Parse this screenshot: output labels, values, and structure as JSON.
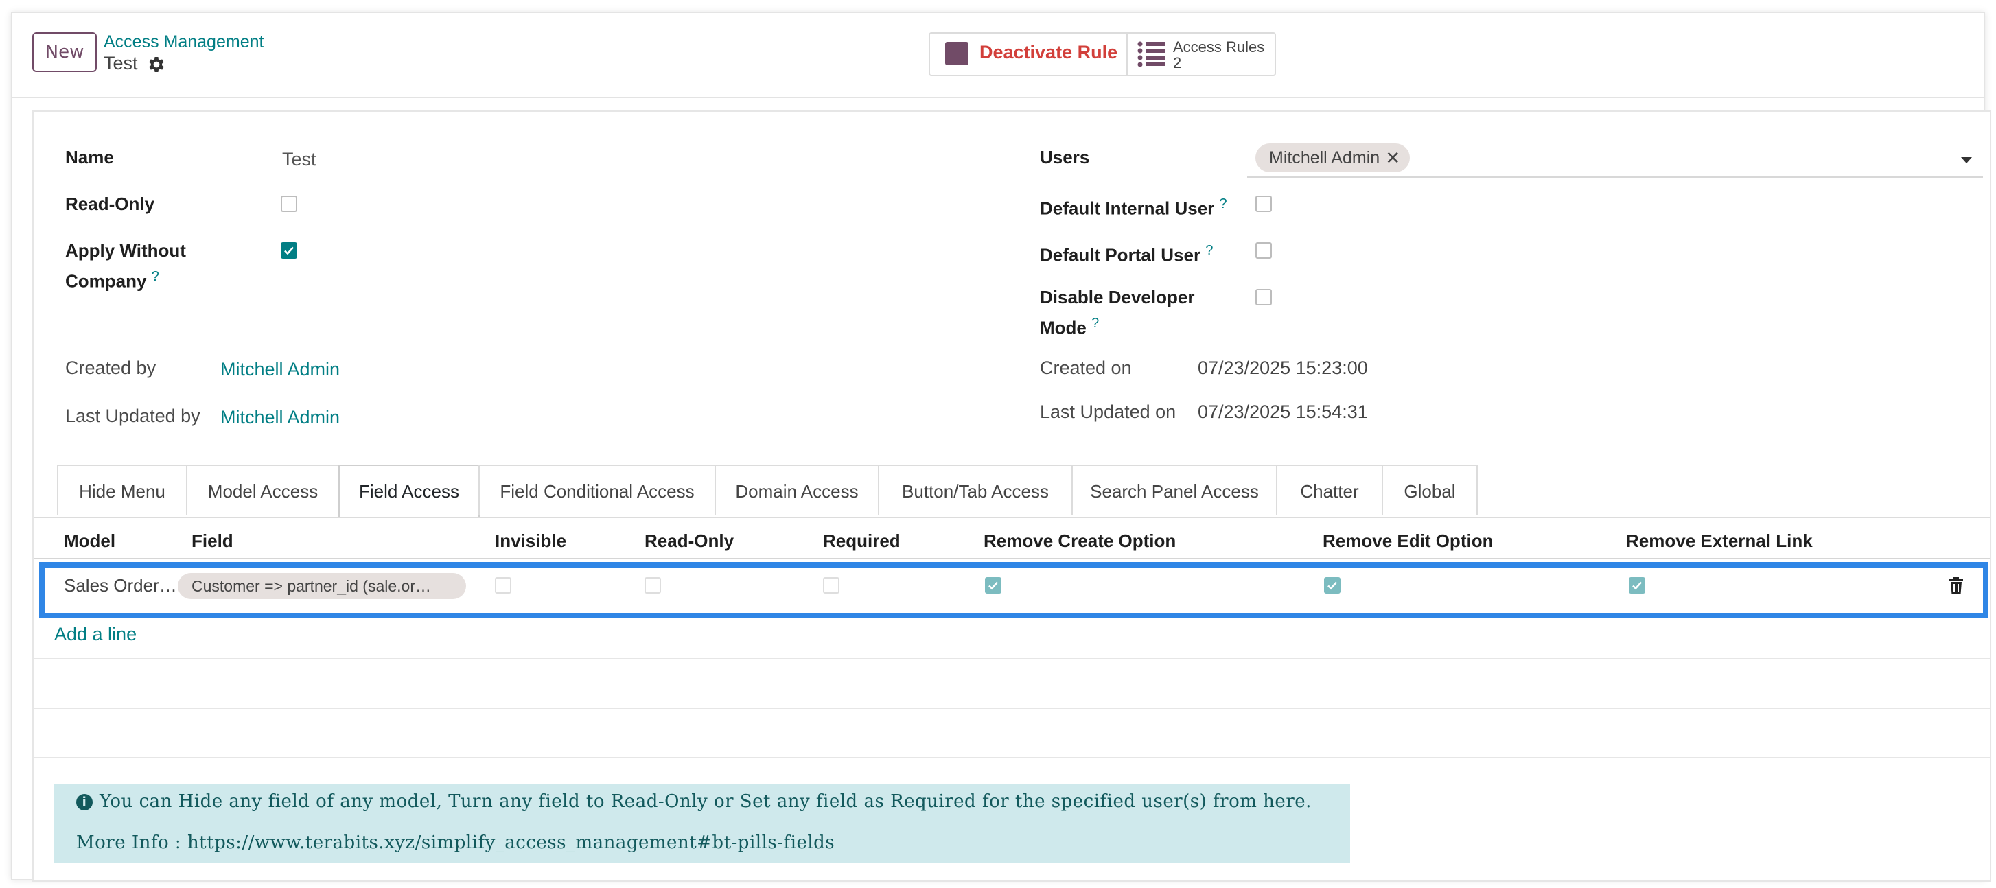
{
  "control_panel": {
    "new_label": "New",
    "breadcrumb_parent": "Access Management",
    "breadcrumb_current": "Test",
    "deactivate_label": "Deactivate Rule",
    "access_rules_label": "Access Rules",
    "access_rules_count": "2"
  },
  "form": {
    "name_label": "Name",
    "name_value": "Test",
    "readonly_label": "Read-Only",
    "apply_without_company_label_1": "Apply Without",
    "apply_without_company_label_2": "Company",
    "help_mark": "?",
    "users_label": "Users",
    "users_tag": "Mitchell Admin",
    "default_internal_label": "Default Internal User",
    "default_portal_label": "Default Portal User",
    "disable_dev_label_1": "Disable Developer",
    "disable_dev_label_2": "Mode",
    "created_by_label": "Created by",
    "created_by_value": "Mitchell Admin",
    "last_updated_by_label": "Last Updated by",
    "last_updated_by_value": "Mitchell Admin",
    "created_on_label": "Created on",
    "created_on_value": "07/23/2025 15:23:00",
    "last_updated_on_label": "Last Updated on",
    "last_updated_on_value": "07/23/2025 15:54:31"
  },
  "tabs": [
    {
      "label": "Hide Menu"
    },
    {
      "label": "Model Access"
    },
    {
      "label": "Field Access"
    },
    {
      "label": "Field Conditional Access"
    },
    {
      "label": "Domain Access"
    },
    {
      "label": "Button/Tab Access"
    },
    {
      "label": "Search Panel Access"
    },
    {
      "label": "Chatter"
    },
    {
      "label": "Global"
    }
  ],
  "table": {
    "headers": [
      "Model",
      "Field",
      "Invisible",
      "Read-Only",
      "Required",
      "Remove Create Option",
      "Remove Edit Option",
      "Remove External Link"
    ],
    "row": {
      "model": "Sales Order…",
      "field": "Customer => partner_id (sale.or…"
    },
    "add_line": "Add a line"
  },
  "info": {
    "line1": "You can Hide any field of any model, Turn any field to Read-Only or Set any field as Required for the specified user(s) from here.",
    "line2_prefix": "More Info : ",
    "line2_link": "https://www.terabits.xyz/simplify_access_management#bt-pills-fields"
  },
  "colors": {
    "brand": "#714b67",
    "link": "#017e84",
    "danger": "#d23f3a",
    "highlight": "#2f86e6",
    "info_bg": "#cfe9ec"
  }
}
